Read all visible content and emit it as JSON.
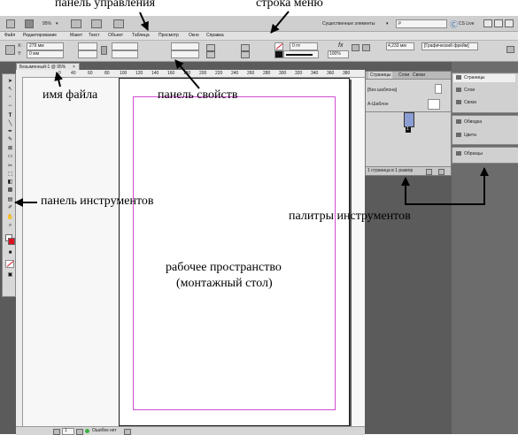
{
  "app_bar": {
    "zoom_label": "95%",
    "workspace_label": "Существенные элементы",
    "search_placeholder": "ρ",
    "cs_live_label": "CS Live"
  },
  "menu": {
    "items": [
      "Файл",
      "Редактирование",
      "Макет",
      "Текст",
      "Объект",
      "Таблица",
      "Просмотр",
      "Окно",
      "Справка"
    ]
  },
  "control_panel": {
    "x_value": "279 мм",
    "y_value": "0 мм",
    "stroke_value": "0 пт",
    "percent_value": "100%",
    "dimension_value": "4,233 мм",
    "frame_style": "[Графический фрейм]"
  },
  "document": {
    "tab_title": "Безымянный-1 @ 95%",
    "ruler_ticks": [
      "0",
      "40",
      "60",
      "80",
      "100",
      "120",
      "140",
      "160",
      "180",
      "200",
      "220",
      "240",
      "260",
      "280",
      "300",
      "320",
      "340",
      "360",
      "380"
    ]
  },
  "pages_panel": {
    "tabs": [
      "Страницы",
      "Слои",
      "Связи"
    ],
    "no_master_label": "[Без шаблона]",
    "a_master_label": "А-Шаблон",
    "page_number": "1",
    "footer_text": "1 страница в 1 развор"
  },
  "dock": {
    "items": [
      "Страницы",
      "Слои",
      "Связи",
      "Обводка",
      "Цвета",
      "Образцы"
    ]
  },
  "status_bar": {
    "page_field": "1",
    "status_text": "Ошибок нет"
  },
  "annotations": {
    "control_panel": "панель управления",
    "menu_bar": "строка меню",
    "file_name": "имя файла",
    "properties_panel": "панель свойств",
    "tools_panel": "панель инструментов",
    "tool_palettes": "палитры инструментов",
    "workspace_line1": "рабочее пространство",
    "workspace_line2": "(монтажный стол)"
  }
}
